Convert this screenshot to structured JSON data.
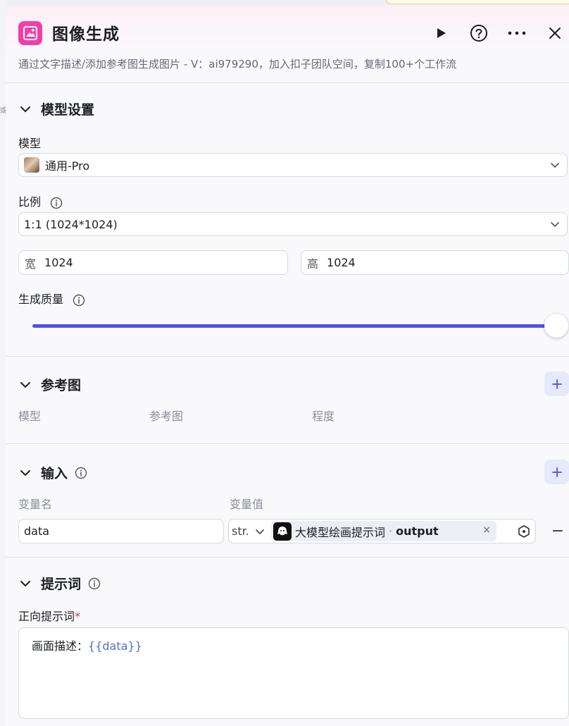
{
  "background": {
    "hint": "或"
  },
  "header": {
    "title": "图像生成",
    "description": "通过文字描述/添加参考图生成图片 - V：ai979290，加入扣子团队空间，复制100+个工作流",
    "accent_color": "#f13ea8",
    "icons": [
      "image-generate-icon",
      "play-icon",
      "help-icon",
      "more-icon",
      "close-icon"
    ]
  },
  "model_settings": {
    "section_title": "模型设置",
    "model_label": "模型",
    "model_value": "通用-Pro",
    "ratio_label": "比例",
    "ratio_value": "1:1 (1024*1024)",
    "width_prefix": "宽",
    "width_value": "1024",
    "height_prefix": "高",
    "height_value": "1024",
    "quality_label": "生成质量",
    "quality_level": 1.0,
    "slider_color": "#4d53e8"
  },
  "reference": {
    "section_title": "参考图",
    "columns": [
      "模型",
      "参考图",
      "程度"
    ]
  },
  "input": {
    "section_title": "输入",
    "columns": [
      "变量名",
      "变量值"
    ],
    "rows": [
      {
        "name": "data",
        "type": "str.",
        "ref_node": "大模型绘画提示词",
        "ref_sep": "·",
        "ref_output": "output",
        "ref_clear": "×"
      }
    ],
    "remove_symbol": "−"
  },
  "prompt": {
    "section_title": "提示词",
    "positive_label": "正向提示词",
    "required_mark": "*",
    "text_prefix": "画面描述：",
    "text_var": "{{data}}",
    "var_color": "#4d6fd6"
  }
}
